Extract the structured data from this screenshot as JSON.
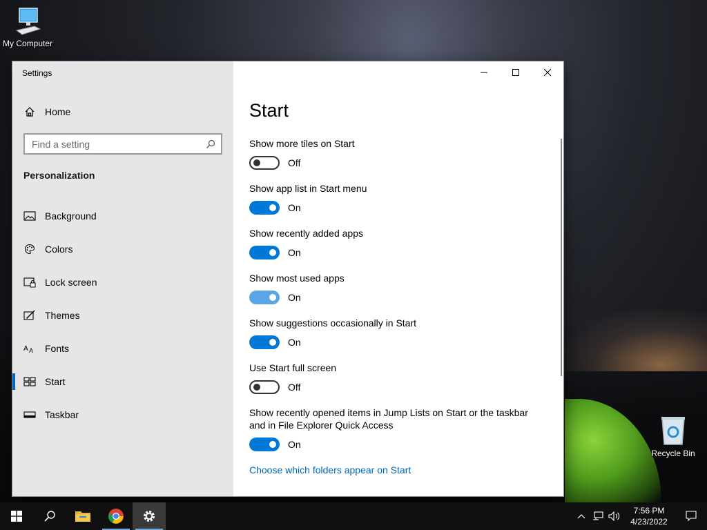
{
  "desktop": {
    "icons": [
      {
        "label": "My Computer"
      },
      {
        "label": "Recycle Bin"
      }
    ]
  },
  "window": {
    "app_title": "Settings",
    "sidebar": {
      "home_label": "Home",
      "search_placeholder": "Find a setting",
      "section_title": "Personalization",
      "items": [
        {
          "label": "Background",
          "icon": "image-icon"
        },
        {
          "label": "Colors",
          "icon": "palette-icon"
        },
        {
          "label": "Lock screen",
          "icon": "lock-screen-icon"
        },
        {
          "label": "Themes",
          "icon": "themes-icon"
        },
        {
          "label": "Fonts",
          "icon": "fonts-icon"
        },
        {
          "label": "Start",
          "icon": "start-layout-icon",
          "active": true
        },
        {
          "label": "Taskbar",
          "icon": "taskbar-icon"
        }
      ]
    },
    "main": {
      "title": "Start",
      "settings": [
        {
          "label": "Show more tiles on Start",
          "state": "Off"
        },
        {
          "label": "Show app list in Start menu",
          "state": "On"
        },
        {
          "label": "Show recently added apps",
          "state": "On"
        },
        {
          "label": "Show most used apps",
          "state": "On"
        },
        {
          "label": "Show suggestions occasionally in Start",
          "state": "On"
        },
        {
          "label": "Use Start full screen",
          "state": "Off"
        },
        {
          "label": "Show recently opened items in Jump Lists on Start or the taskbar and in File Explorer Quick Access",
          "state": "On"
        }
      ],
      "link_label": "Choose which folders appear on Start"
    }
  },
  "taskbar": {
    "time": "7:56 PM",
    "date": "4/23/2022"
  },
  "colors": {
    "accent": "#0078d7",
    "link": "#0067b8",
    "sidebar_bg": "#e6e6e6"
  }
}
